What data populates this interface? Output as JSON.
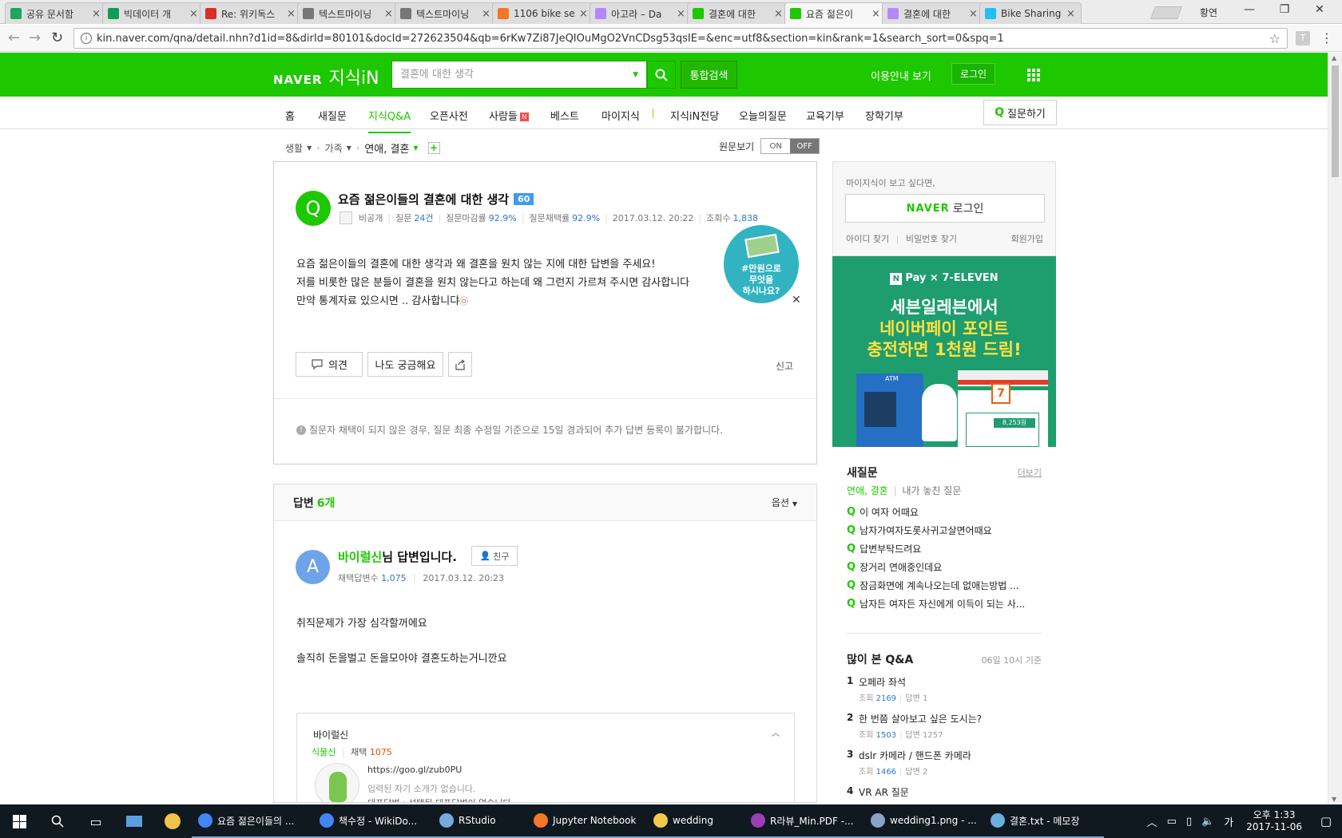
{
  "browser": {
    "tabs": [
      {
        "label": "공유 문서함",
        "color": "#1fa463",
        "icon": "drive-icon"
      },
      {
        "label": "빅데이터 개",
        "color": "#0f9d58",
        "icon": "sheets-icon"
      },
      {
        "label": "Re: 위키독스",
        "color": "#d93025",
        "icon": "gmail-icon"
      },
      {
        "label": "텍스트마이닝",
        "color": "#777777",
        "icon": "document-icon"
      },
      {
        "label": "텍스트마이닝",
        "color": "#777777",
        "icon": "document-icon"
      },
      {
        "label": "1106 bike se",
        "color": "#f37726",
        "icon": "jupyter-icon"
      },
      {
        "label": "아고라 – Da",
        "color": "#b388ff",
        "icon": "agora-icon"
      },
      {
        "label": "결혼에 대한",
        "color": "#1ec800",
        "icon": "naver-icon"
      },
      {
        "label": "요즘 젊은이",
        "color": "#1ec800",
        "icon": "naver-kin-icon",
        "active": true
      },
      {
        "label": "결혼에 대한",
        "color": "#b388ff",
        "icon": "agora-icon"
      },
      {
        "label": "Bike Sharing",
        "color": "#20beff",
        "icon": "kaggle-icon"
      }
    ],
    "user": "황연",
    "url": "kin.naver.com/qna/detail.nhn?d1id=8&dirId=80101&docId=272623504&qb=6rKw7Zi87JeQIOuMgO2VnCDsg53qsIE=&enc=utf8&section=kin&rank=1&search_sort=0&spq=1"
  },
  "header": {
    "brand": "NAVER",
    "service": "지식iN",
    "search_placeholder": "결혼에 대한 생각",
    "unified_search": "통합검색",
    "guide": "이용안내 보기",
    "login": "로그인"
  },
  "subnav": {
    "items": [
      "홈",
      "새질문",
      "지식Q&A",
      "오픈사전",
      "사람들",
      "베스트",
      "마이지식",
      "지식iN전당",
      "오늘의질문",
      "교육기부",
      "장학기부"
    ],
    "new_badge": "N",
    "ask": "질문하기"
  },
  "breadcrumb": {
    "items": [
      "생활",
      "가족",
      "연애, 결혼"
    ],
    "original_view_label": "원문보기",
    "toggle_on": "ON",
    "toggle_off": "OFF"
  },
  "question": {
    "title": "요즘 젊은이들의 결혼에 대한 생각",
    "points": "60",
    "author": "비공개",
    "meta": {
      "questions_label": "질문",
      "questions_value": "24건",
      "close_rate_label": "질문마감률",
      "close_rate_value": "92.9%",
      "adopt_rate_label": "질문채택률",
      "adopt_rate_value": "92.9%",
      "date": "2017.03.12. 20:22",
      "views_label": "조회수",
      "views_value": "1,838"
    },
    "body": [
      "요즘 젊은이들의 결혼에 대한 생각과 왜 결혼을 원치 않는 지에 대한 답변을 주세요!",
      "저를 비롯한 많은 분들이 결혼을 원치 않는다고 하는데 왜 그런지 가르쳐 주시면 감사합니다",
      "만약 통계자료 있으시면 .. 감사합니댜"
    ],
    "ad_bubble": [
      "#만원으로",
      "무엇을",
      "하시나요?"
    ],
    "buttons": {
      "opinion": "의견",
      "me_too": "나도 궁금해요"
    },
    "report": "신고",
    "notice": "질문자 채택이 되지 않은 경우, 질문 최종 수정일 기준으로 15일 경과되어 추가 답변 등록이 불가합니다."
  },
  "answers": {
    "label": "답변",
    "count": "6개",
    "options": "옵션",
    "first": {
      "avatar_letter": "A",
      "nickname": "바이럴신",
      "title_suffix": "님 답변입니다.",
      "friend": "친구",
      "adopt_label": "채택답변수",
      "adopt_value": "1,075",
      "date": "2017.03.12. 20:23",
      "body": [
        "취직문제가 가장 심각할꺼에요",
        "솔직히 돈을벌고 돈을모아야 결혼도하는거니깐요"
      ],
      "profile": {
        "name": "바이럴신",
        "grade": "식물신",
        "adopt_label": "채택",
        "adopt_value": "1075",
        "link": "https://goo.gl/zub0PU",
        "intro": "입력된 자기 소개가 없습니다.",
        "rep": "대표답변 : 선택된 대표답변이 없습니다."
      }
    }
  },
  "sidebar": {
    "login_hint": "마이지식이 보고 싶다면,",
    "naver_login_brand": "NAVER",
    "naver_login_label": "로그인",
    "find_id": "아이디 찾기",
    "find_pw": "비밀번호 찾기",
    "join": "회원가입",
    "ad": {
      "brand": "Pay × 7-ELEVEN",
      "npay_mark": "N",
      "line1": "세븐일레븐에서",
      "line2": "네이버페이 포인트",
      "line3": "충전하면 1천원 드림!",
      "atm": "ATM",
      "amount": "8,253원"
    },
    "new_questions": {
      "title": "새질문",
      "more": "더보기",
      "tab_on": "연애, 결혼",
      "tab_off": "내가 놓친 질문",
      "items": [
        "이 여자 어때요",
        "남자가여자도롯사귀고살면어때요",
        "답변부탁드려요",
        "장거리 연애중인데요",
        "잠금화면에 계속나오는데 없애는방법 ...",
        "남자든 여자든 자신에게 이득이 되는 사..."
      ]
    },
    "popular": {
      "title": "많이 본 Q&A",
      "basis": "06일 10시 기준",
      "items": [
        {
          "rank": "1",
          "title": "오페라 좌석",
          "views": "2169",
          "answers": "1"
        },
        {
          "rank": "2",
          "title": "한 번쯤 살아보고 싶은 도시는?",
          "views": "1503",
          "answers": "1257"
        },
        {
          "rank": "3",
          "title": "dslr 카메라 / 핸드폰 카메라",
          "views": "1466",
          "answers": "2"
        },
        {
          "rank": "4",
          "title": "VR AR 질문",
          "views": "",
          "answers": ""
        }
      ],
      "views_label": "조회",
      "answers_label": "답변"
    }
  },
  "taskbar": {
    "apps": [
      {
        "label": "요즘 젊은이들의 ...",
        "color": "#4285f4"
      },
      {
        "label": "책수정 - WikiDo...",
        "color": "#4285f4"
      },
      {
        "label": "RStudio",
        "color": "#75aadb"
      },
      {
        "label": "Jupyter Notebook",
        "color": "#f37726"
      },
      {
        "label": "wedding",
        "color": "#f2c94c"
      },
      {
        "label": "R라뷰_Min.PDF -...",
        "color": "#9b3fb3"
      },
      {
        "label": "wedding1.png - ...",
        "color": "#8aa4c8"
      },
      {
        "label": "결혼.txt - 메모장",
        "color": "#6ab0de"
      }
    ],
    "ime": "가",
    "time": "오후 1:33",
    "date": "2017-11-06"
  }
}
